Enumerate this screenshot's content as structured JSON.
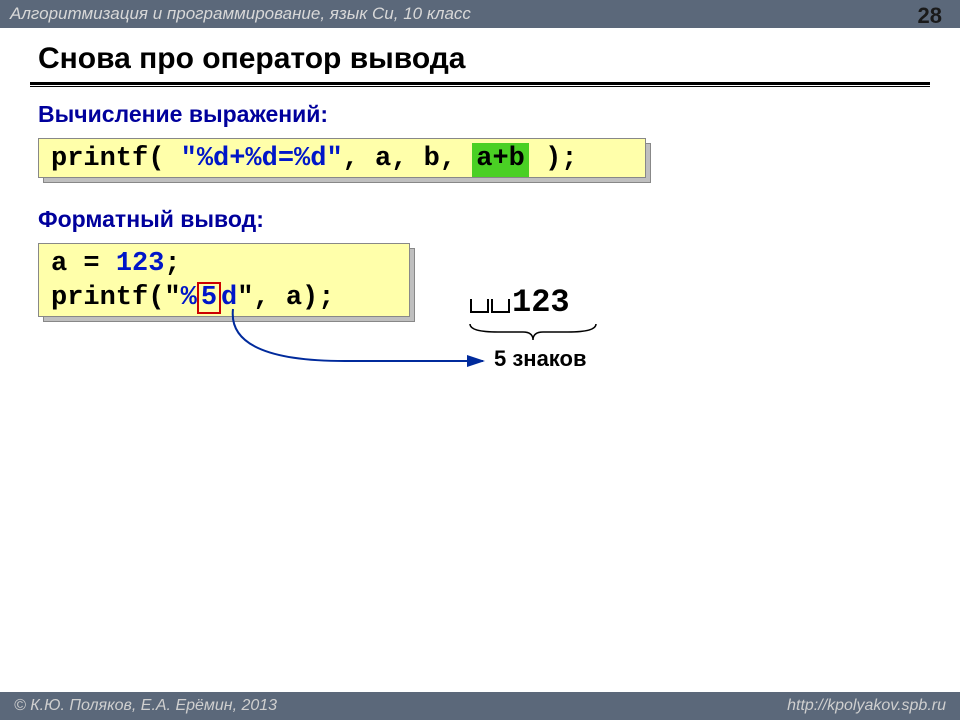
{
  "header": "Алгоритмизация и программирование, язык Си, 10 класс",
  "page_number": "28",
  "title": "Снова про оператор вывода",
  "sub1": "Вычисление выражений:",
  "code1": {
    "p1": "printf( ",
    "fmt": "\"%d+%d=%d\"",
    "p2": ", a, b, ",
    "expr": "a+b",
    "p3": " );"
  },
  "sub2": "Форматный вывод:",
  "code2": {
    "l1a": "a = ",
    "l1num": "123",
    "l1b": ";",
    "l2a": "printf(\"",
    "l2pct": "%",
    "l2five": "5",
    "l2d": "d",
    "l2b": "\", a);"
  },
  "output_value": "123",
  "annotation": "5 знаков",
  "footer_left": "© К.Ю. Поляков, Е.А. Ерёмин, 2013",
  "footer_right": "http://kpolyakov.spb.ru"
}
